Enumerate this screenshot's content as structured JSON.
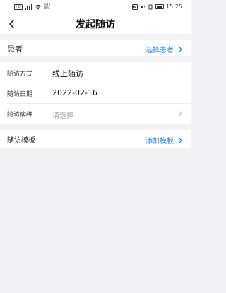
{
  "status_bar": {
    "network": "HD",
    "net_speed_value": "541",
    "net_speed_unit": "B/s",
    "time": "15:25"
  },
  "nav": {
    "title": "发起随访"
  },
  "patient": {
    "label": "患者",
    "action": "选择患者"
  },
  "form": {
    "method_label": "随访方式",
    "method_value": "线上随访",
    "date_label": "随访日期",
    "date_value": "2022-02-16",
    "disease_label": "随访病种",
    "disease_placeholder": "请选择"
  },
  "template": {
    "label": "随访模板",
    "action": "添加模板"
  },
  "colors": {
    "accent": "#2f86d4",
    "background": "#f3f3f5",
    "placeholder": "#a3a3a3"
  }
}
